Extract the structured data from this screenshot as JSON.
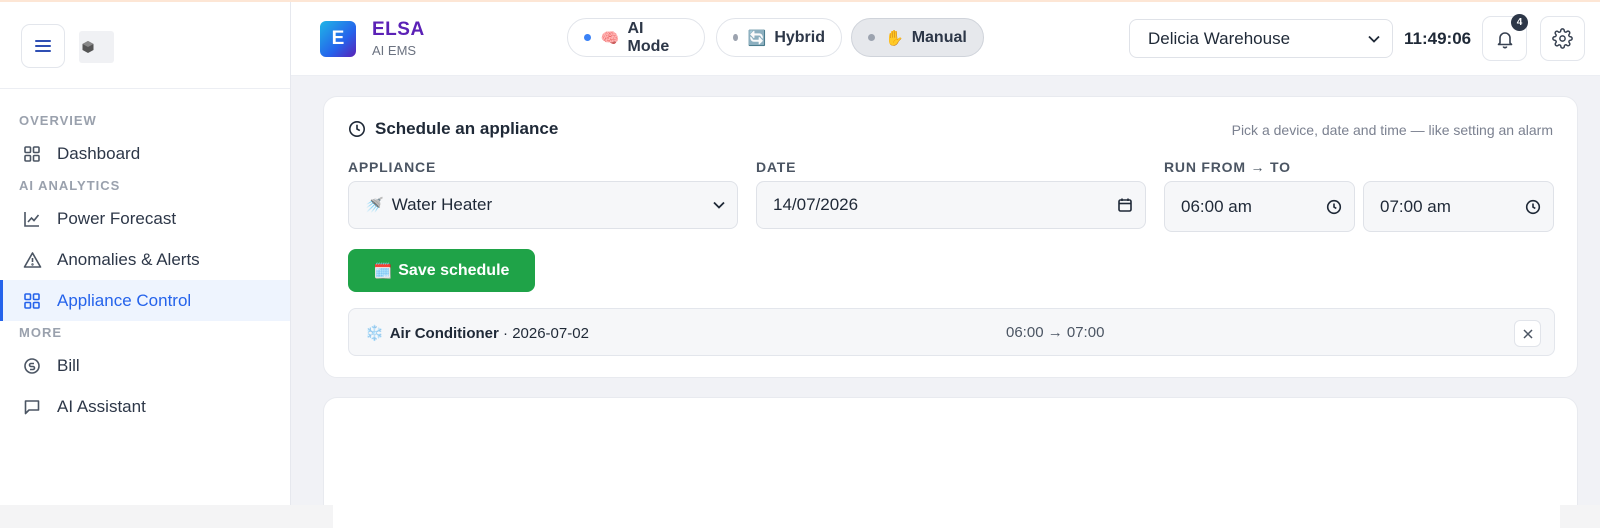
{
  "sidebar": {
    "sections": {
      "overview": "OVERVIEW",
      "ai_analytics": "AI ANALYTICS",
      "more": "MORE"
    },
    "items": [
      {
        "label": "Dashboard",
        "icon": "grid-icon"
      },
      {
        "label": "Power Forecast",
        "icon": "line-chart-icon"
      },
      {
        "label": "Anomalies & Alerts",
        "icon": "warning-icon"
      },
      {
        "label": "Appliance Control",
        "icon": "grid-icon",
        "active": true
      },
      {
        "label": "Bill",
        "icon": "currency-icon"
      },
      {
        "label": "AI Assistant",
        "icon": "chat-icon"
      }
    ]
  },
  "header": {
    "brand_name": "ELSA",
    "brand_letter": "E",
    "brand_sub": "AI EMS",
    "modes": [
      {
        "label": "AI Mode",
        "emoji": "🧠",
        "dot_color": "#3b82f6"
      },
      {
        "label": "Hybrid",
        "emoji": "🔄",
        "dot_color": "#9ca3af"
      },
      {
        "label": "Manual",
        "emoji": "✋",
        "dot_color": "#9ca3af",
        "active": true
      }
    ],
    "site_select": "Delicia Warehouse",
    "clock": "11:49:06",
    "notification_count": "4"
  },
  "schedule_card": {
    "title": "Schedule an appliance",
    "hint": "Pick a device, date and time — like setting an alarm",
    "appliance_label": "APPLIANCE",
    "appliance_value": "Water Heater",
    "appliance_emoji": "🚿",
    "date_label": "DATE",
    "date_value": "14/07/2026",
    "run_label": "RUN FROM → TO",
    "from_value": "06:00 am",
    "to_value": "07:00 am",
    "save_label": "Save schedule",
    "save_emoji": "🗓️",
    "scheduled": [
      {
        "emoji": "❄️",
        "name": "Air Conditioner",
        "date": " · 2026-07-02",
        "time": "06:00 → 07:00"
      }
    ]
  },
  "colors": {
    "accent": "#2563eb",
    "save_button": "#1fa348",
    "brand": "#5b21b6"
  }
}
